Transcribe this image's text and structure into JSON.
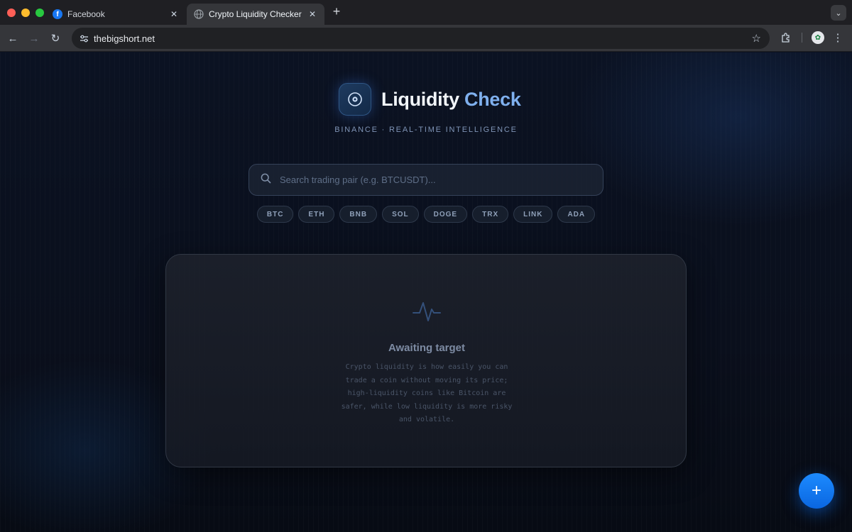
{
  "browser": {
    "tabs": [
      {
        "title": "Facebook",
        "favicon": "facebook-icon",
        "active": false
      },
      {
        "title": "Crypto Liquidity Checker - TB",
        "favicon": "globe-icon",
        "active": true
      }
    ],
    "new_tab_symbol": "+",
    "url": "thebigshort.net"
  },
  "brand": {
    "title_part1": "Liquidity",
    "title_part2": "Check",
    "tagline": "BINANCE · REAL-TIME INTELLIGENCE"
  },
  "search": {
    "placeholder": "Search trading pair (e.g. BTCUSDT)...",
    "value": ""
  },
  "quick_pairs": [
    "BTC",
    "ETH",
    "BNB",
    "SOL",
    "DOGE",
    "TRX",
    "LINK",
    "ADA"
  ],
  "empty_state": {
    "icon": "pulse-icon",
    "title": "Awaiting target",
    "description": "Crypto liquidity is how easily you can trade a coin without moving its price; high-liquidity coins like Bitcoin are safer, while low liquidity is more risky and volatile."
  },
  "fab": {
    "label": "+"
  },
  "colors": {
    "background": "#0b1120",
    "accent_blue": "#7fb0ee",
    "fab_blue": "#0a66e0"
  }
}
